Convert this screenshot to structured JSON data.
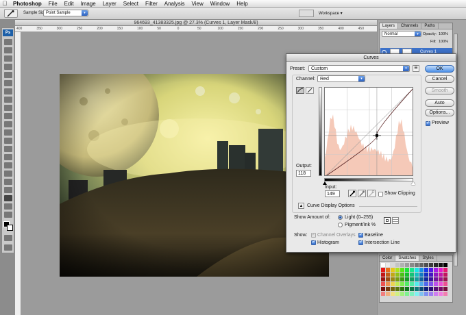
{
  "menubar": {
    "app_name": "Photoshop",
    "items": [
      "File",
      "Edit",
      "Image",
      "Layer",
      "Select",
      "Filter",
      "Analysis",
      "View",
      "Window",
      "Help"
    ]
  },
  "options_bar": {
    "sample_size_label": "Sample Size:",
    "sample_size_value": "Point Sample",
    "workspace_label": "Workspace ▾"
  },
  "document": {
    "title": "964693_41383325.jpg @ 27.3% (Curves 1, Layer Mask/8)",
    "ruler_ticks": [
      "400",
      "350",
      "300",
      "250",
      "200",
      "150",
      "100",
      "50",
      "0",
      "50",
      "100",
      "150",
      "200",
      "250",
      "300",
      "350",
      "400",
      "450"
    ]
  },
  "panels": {
    "layers": {
      "tabs": [
        "Layers",
        "Channels",
        "Paths"
      ],
      "blend_mode": "Normal",
      "opacity_label": "Opacity:",
      "opacity_value": "100%",
      "fill_label": "Fill:",
      "fill_value": "100%",
      "layer_name": "Curves 1"
    },
    "swatches": {
      "tabs": [
        "Color",
        "Swatches",
        "Styles"
      ]
    }
  },
  "curves": {
    "title": "Curves",
    "preset_label": "Preset:",
    "preset_value": "Custom",
    "channel_label": "Channel:",
    "channel_value": "Red",
    "output_label": "Output:",
    "output_value": "118",
    "input_label": "Input:",
    "input_value": "149",
    "show_clipping_label": "Show Clipping",
    "curve_display_options_label": "Curve Display Options",
    "show_amount_label": "Show Amount of:",
    "light_label": "Light  (0–255)",
    "pigment_label": "Pigment/Ink %",
    "show_label": "Show:",
    "channel_overlays_label": "Channel Overlays",
    "baseline_label": "Baseline",
    "histogram_label": "Histogram",
    "intersection_line_label": "Intersection Line",
    "buttons": {
      "ok": "OK",
      "cancel": "Cancel",
      "smooth": "Smooth",
      "auto": "Auto",
      "options": "Options..."
    },
    "preview_label": "Preview",
    "curve_points_input_output": [
      [
        0,
        0
      ],
      [
        149,
        118
      ],
      [
        255,
        255
      ]
    ],
    "colors": {
      "histogram": "#f5c9b8",
      "curve": "#5e2a2a",
      "accent": "#3a6db5"
    }
  }
}
